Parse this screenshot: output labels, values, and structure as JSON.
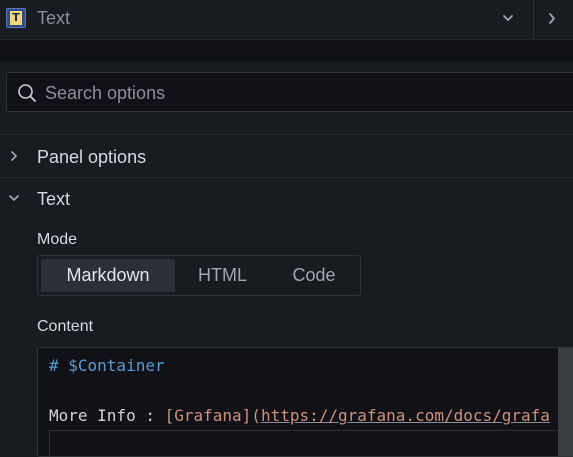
{
  "header": {
    "viz_icon_letter": "T",
    "viz_name": "Text",
    "dropdown_icon": "chevron-down-icon",
    "collapse_icon": "chevron-right-icon"
  },
  "search": {
    "placeholder": "Search options",
    "value": "",
    "icon": "search-icon"
  },
  "sections": {
    "panel_options": {
      "label": "Panel options",
      "expanded": false
    },
    "text": {
      "label": "Text",
      "expanded": true
    }
  },
  "mode": {
    "label": "Mode",
    "options": [
      "Markdown",
      "HTML",
      "Code"
    ],
    "selected": "Markdown"
  },
  "content": {
    "label": "Content",
    "line1": "# $Container",
    "line2_prefix": "More Info : ",
    "line2_link_text": "[Grafana]",
    "line2_paren": "(",
    "line2_url": "https://grafana.com/docs/grafa"
  },
  "colors": {
    "background": "#181b1f",
    "heading_token": "#569cd6",
    "link_token": "#ce9178",
    "icon_badge": "#2f4c86"
  }
}
